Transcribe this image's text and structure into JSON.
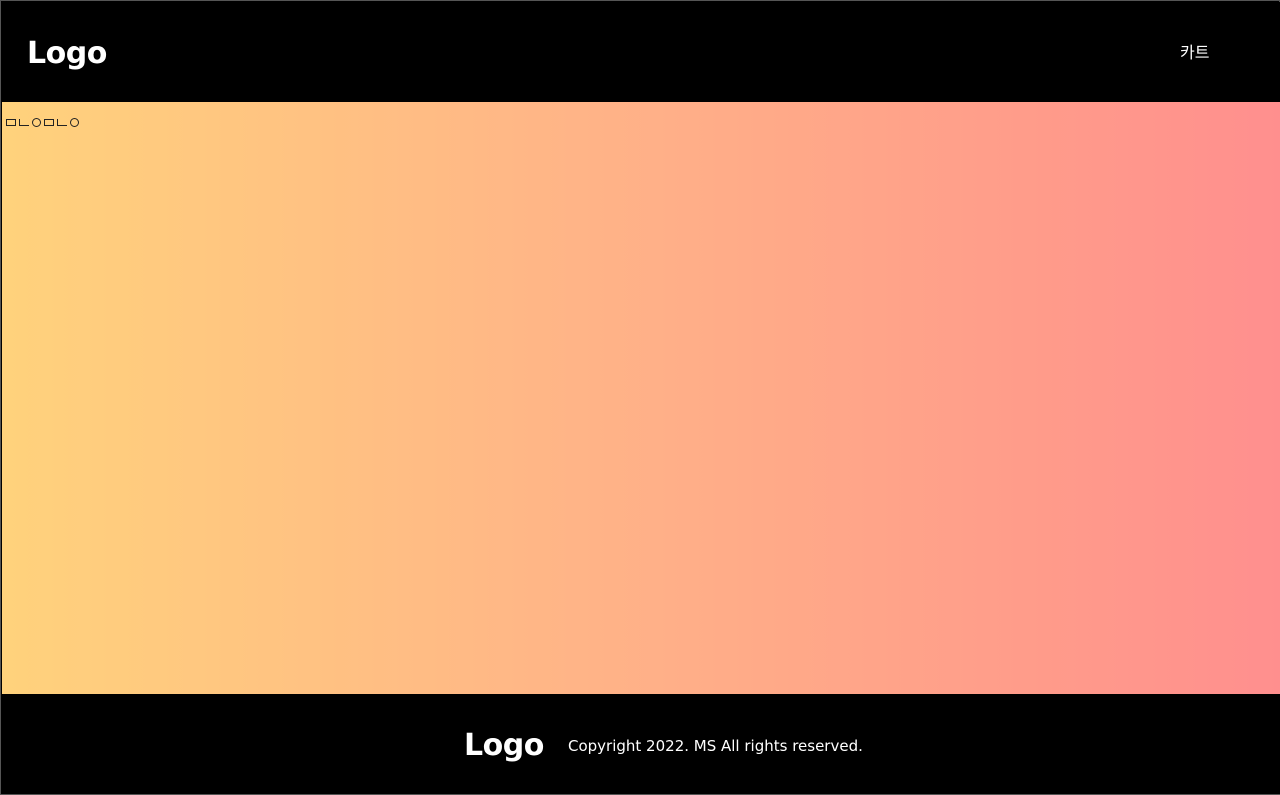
{
  "header": {
    "logo": "Logo",
    "nav": {
      "cart": "카트"
    }
  },
  "main": {
    "background_colors": [
      "#ffd27c",
      "#ffb487",
      "#ff9c8a",
      "#ff8f8e"
    ],
    "glyph_row": [
      "tofu-box",
      "tofu-l",
      "tofu-o",
      "tofu-box",
      "tofu-l",
      "tofu-o"
    ]
  },
  "footer": {
    "logo": "Logo",
    "copyright": "Copyright 2022. MS All rights reserved."
  }
}
